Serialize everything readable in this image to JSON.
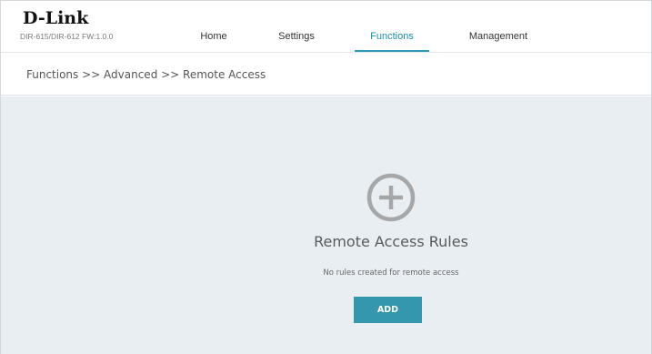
{
  "brand": {
    "logo": "D-Link",
    "model_firmware": "DIR-615/DIR-612  FW:1.0.0"
  },
  "nav": {
    "tabs": [
      {
        "label": "Home",
        "active": false
      },
      {
        "label": "Settings",
        "active": false
      },
      {
        "label": "Functions",
        "active": true
      },
      {
        "label": "Management",
        "active": false
      }
    ]
  },
  "breadcrumb": "Functions >> Advanced >> Remote Access",
  "main": {
    "icon": "add-circle-icon",
    "title": "Remote Access Rules",
    "empty_message": "No rules created for remote access",
    "add_label": "ADD"
  },
  "colors": {
    "accent": "#2d9bb8",
    "button": "#3497ad",
    "content_bg": "#e9eef3",
    "icon_gray": "#a5a7a9"
  }
}
